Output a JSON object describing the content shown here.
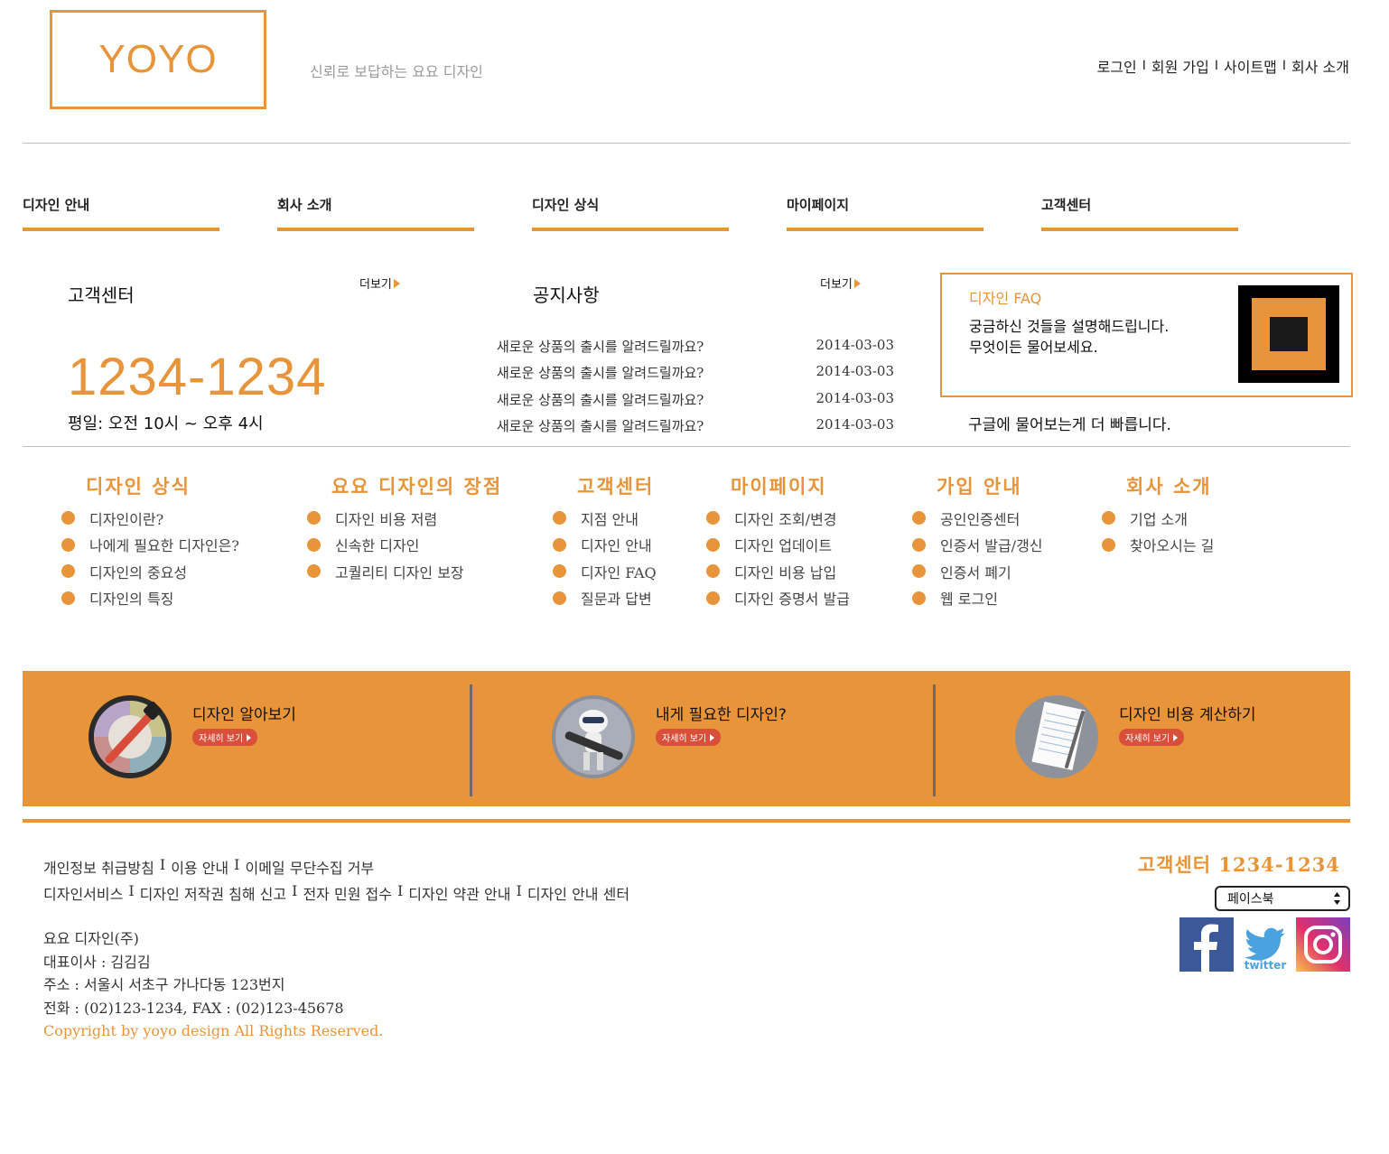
{
  "header": {
    "logo": "YOYO",
    "tagline": "신뢰로 보답하는 요요 디자인",
    "top_links": [
      "로그인",
      "회원 가입",
      "사이트맵",
      "회사 소개"
    ],
    "separator": "I"
  },
  "nav": [
    "디자인 안내",
    "회사 소개",
    "디자인 상식",
    "마이페이지",
    "고객센터"
  ],
  "customer_center": {
    "title": "고객센터",
    "more": "더보기",
    "phone": "1234-1234",
    "hours": "평일: 오전 10시 ~ 오후 4시"
  },
  "notice": {
    "title": "공지사항",
    "more": "더보기",
    "items": [
      {
        "title": "새로운 상품의 출시를 알려드릴까요?",
        "date": "2014-03-03"
      },
      {
        "title": "새로운 상품의 출시를 알려드릴까요?",
        "date": "2014-03-03"
      },
      {
        "title": "새로운 상품의 출시를 알려드릴까요?",
        "date": "2014-03-03"
      },
      {
        "title": "새로운 상품의 출시를 알려드릴까요?",
        "date": "2014-03-03"
      }
    ]
  },
  "faq": {
    "title": "디자인 FAQ",
    "line1": "궁금하신 것들을 설명해드립니다.",
    "line2": "무엇이든 물어보세요.",
    "google_note": "구글에 물어보는게 더 빠릅니다."
  },
  "sitemap": [
    {
      "heading": "디자인 상식",
      "items": [
        "디자인이란?",
        "나에게 필요한 디자인은?",
        "디자인의 중요성",
        "디자인의 특징"
      ]
    },
    {
      "heading": "요요 디자인의 장점",
      "items": [
        "디자인 비용 저렴",
        "신속한 디자인",
        "고퀄리티 디자인 보장"
      ]
    },
    {
      "heading": "고객센터",
      "items": [
        "지점 안내",
        "디자인 안내",
        "디자인 FAQ",
        "질문과 답변"
      ]
    },
    {
      "heading": "마이페이지",
      "items": [
        "디자인 조회/변경",
        "디자인 업데이트",
        "디자인 비용 납입",
        "디자인 증명서 발급"
      ]
    },
    {
      "heading": "가입 안내",
      "items": [
        "공인인증센터",
        "인증서 발급/갱신",
        "인증서 폐기",
        "웹 로그인"
      ]
    },
    {
      "heading": "회사 소개",
      "items": [
        "기업 소개",
        "찾아오시는 길"
      ]
    }
  ],
  "band": [
    {
      "title": "디자인 알아보기",
      "button": "자세히 보기",
      "icon": "color-picker-icon"
    },
    {
      "title": "내게 필요한 디자인?",
      "button": "자세히 보기",
      "icon": "robot-icon"
    },
    {
      "title": "디자인 비용 계산하기",
      "button": "자세히 보기",
      "icon": "notepad-icon"
    }
  ],
  "footer": {
    "links_row1": [
      "개인정보 취급방침",
      "이용 안내",
      "이메일 무단수집 거부"
    ],
    "links_row2": [
      "디자인서비스",
      "디자인 저작권 침해 신고",
      "전자 민원 접수",
      "디자인 약관 안내",
      "디자인 안내 센터"
    ],
    "company": "요요 디자인(주)",
    "ceo": "대표이사 : 김김김",
    "address": "주소 : 서울시 서초구 가나다동 123번지",
    "tel": "전화 : (02)123-1234, FAX : (02)123-45678",
    "copyright": "Copyright by yoyo design All Rights Reserved.",
    "cs_phone": "고객센터 1234-1234",
    "sns_select": "페이스북",
    "twitter_label": "twitter"
  },
  "colors": {
    "accent": "#E8943A",
    "facebook": "#3B5998",
    "twitter": "#4AA3DF"
  }
}
